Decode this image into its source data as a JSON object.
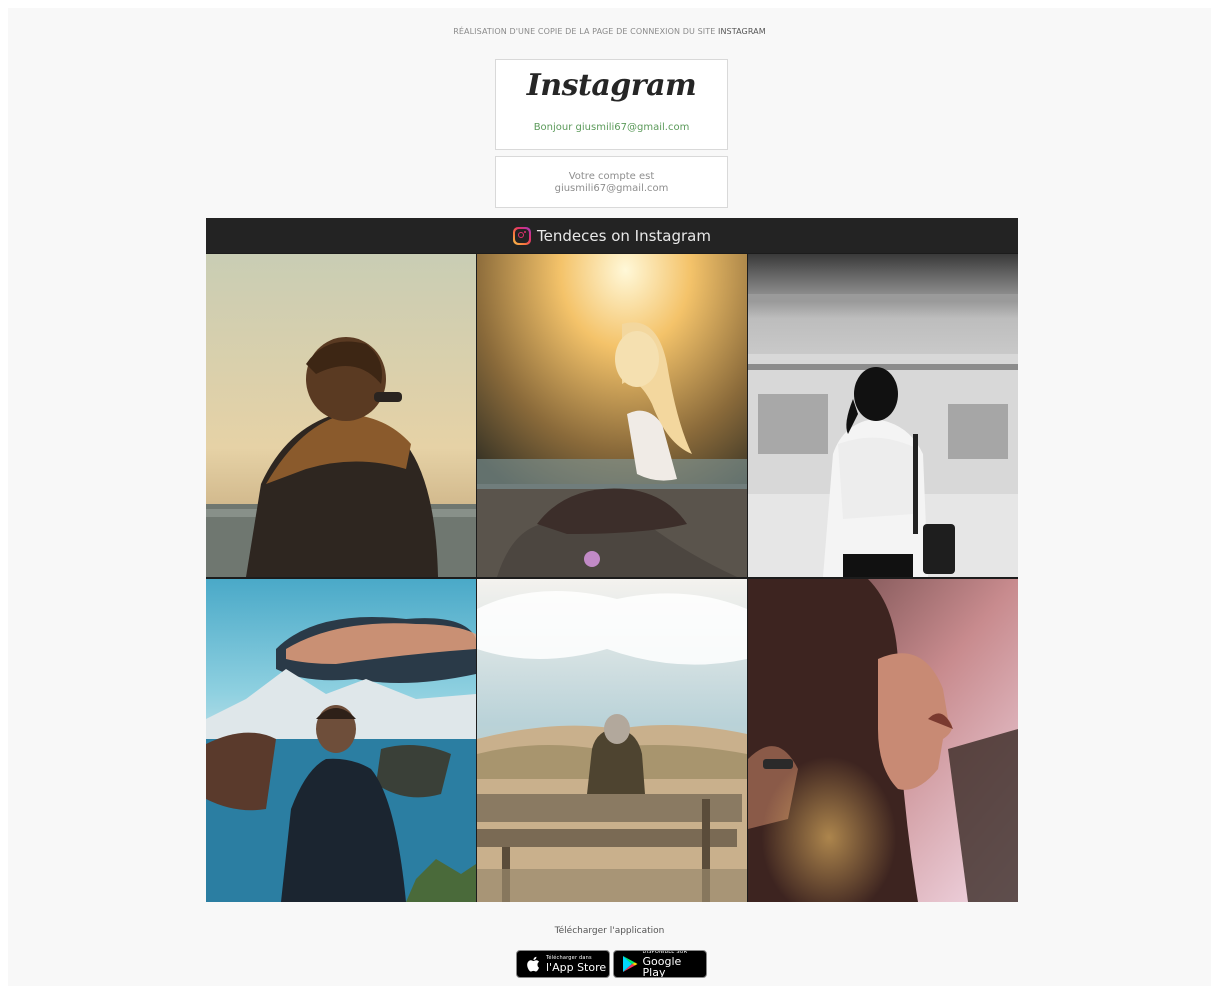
{
  "caption": {
    "prefix": "RÉALISATION D'UNE COPIE DE LA PAGE DE CONNEXION DU SITE ",
    "highlight": "INSTAGRAM"
  },
  "login_card": {
    "logo_text": "Instagram",
    "greeting": "Bonjour giusmili67@gmail.com"
  },
  "account_card": {
    "line1": "Votre compte est",
    "line2": "giusmili67@gmail.com"
  },
  "gallery": {
    "icon": "instagram-icon",
    "title": "Tendeces on Instagram",
    "photos": [
      {
        "subject": "man-with-scarf-sunset"
      },
      {
        "subject": "woman-sitting-sunlight"
      },
      {
        "subject": "woman-train-platform-bw"
      },
      {
        "subject": "man-mountain-lake"
      },
      {
        "subject": "person-on-bench-dunes"
      },
      {
        "subject": "woman-profile-pink-light"
      }
    ]
  },
  "download": {
    "label": "Télécharger l'application",
    "app_store": {
      "small": "Télécharger dans",
      "big": "l'App Store",
      "icon": "apple-icon"
    },
    "google_play": {
      "small": "DISPONIBLE SUR",
      "big": "Google Play",
      "icon": "play-triangle-icon"
    }
  }
}
